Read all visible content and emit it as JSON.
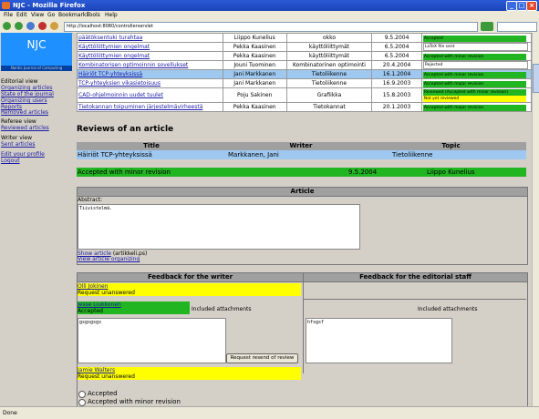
{
  "window": {
    "title": "NJC - Mozilla Firefox"
  },
  "menu": [
    "File",
    "Edit",
    "View",
    "Go",
    "Bookmarks",
    "Tools",
    "Help"
  ],
  "url": "http://localhost:8080/controllerservlet",
  "logo": {
    "title": "NJC",
    "subtitle": "Nordic Journal of Computing"
  },
  "nav": {
    "editorial_view": "Editorial view",
    "organizing_articles": "Organizing articles",
    "state_of_journal": "State of the journal",
    "organizing_users": "Organizing users",
    "reports": "Reports",
    "removed_articles": "Removed articles",
    "referee_view": "Referee view",
    "reviewed_articles": "Reviewed articles",
    "writer_view": "Writer view",
    "sent_articles": "Sent articles",
    "edit_profile": "Edit your profile",
    "logout": "Logout"
  },
  "articles": [
    {
      "title": "päätöksentuki turahtaa",
      "person": "Liippo Kunelius",
      "topic": "okko",
      "date": "9.5.2004",
      "status": "Accepted",
      "color": "#22b522"
    },
    {
      "title": "Käyttöliittymien ongelmat",
      "person": "Pekka Kaasinen",
      "topic": "käyttöliittymät",
      "date": "6.5.2004",
      "status": "LaTeX file sent",
      "color": "#ffffff"
    },
    {
      "title": "Käyttöliittymien ongelmat",
      "person": "Pekka Kaasinen",
      "topic": "käyttöliittymät",
      "date": "6.5.2004",
      "status": "Accepted with minor revision",
      "color": "#22b522"
    },
    {
      "title": "Kombinatorisen optimoinnin sovellukset",
      "person": "Jouni Tuominen",
      "topic": "Kombinatorinen optimointi",
      "date": "20.4.2004",
      "status": "Rejected",
      "color": "#ffffff"
    },
    {
      "title": "Häiriöt TCP-yhteyksissä",
      "person": "Jani Markkanen",
      "topic": "Tietoliikenne",
      "date": "16.1.2004",
      "status": "Accepted with minor revision",
      "color": "#22b522"
    },
    {
      "title": "TCP-yhteyksien vikasietoisuus",
      "person": "Jani Markkanen",
      "topic": "Tietoliikenne",
      "date": "16.9.2003",
      "status": "Accepted with major revision",
      "color": "#22b522"
    },
    {
      "title": "CAD-ohjelmoinnin uudet tuulet",
      "person": "Poju Sakinen",
      "topic": "Grafiikka",
      "date": "15.8.2003",
      "status": "Reviewed (Accepted with minor revision)",
      "status2": "Not yet reviewed",
      "color": "#22b522"
    },
    {
      "title": "Tietokannan toipuminen järjestelmävirheestä",
      "person": "Pekka Kaasinen",
      "topic": "Tietokannat",
      "date": "20.1.2003",
      "status": "Accepted with major revision",
      "color": "#22b522"
    }
  ],
  "review": {
    "heading": "Reviews of an article",
    "col_title": "Title",
    "col_writer": "Writer",
    "col_topic": "Topic",
    "title": "Häiriöt TCP-yhteyksissä",
    "writer": "Markkanen, Jani",
    "topic": "Tietoliikenne",
    "decision": "Accepted with minor revision",
    "decision_date": "9.5.2004",
    "decided_by": "Liippo Kunelius",
    "article_header": "Article",
    "abstract_label": "Abstract:",
    "abstract_text": "Tiivistelmä.",
    "show_article": "Show article",
    "show_article_file": "(artikkeli.ps)",
    "view_organizing": "View article organizing",
    "fb_writer_header": "Feedback for the writer",
    "fb_editorial_header": "Feedback for the editorial staff",
    "reviewer1_name": "Olli Jokinen",
    "reviewer1_state": "Request unanswered",
    "reviewer2_name": "Jesse Liukkonen",
    "reviewer2_state": "Accepted",
    "included_attachments": "Included attachments",
    "included_attachments2": "Included attachments",
    "writer_feedback_text": "gsgsgsgs",
    "editorial_feedback_text": "hfsgsf",
    "resend_button": "Request resend of review",
    "reviewer3_name": "Jamie Walters",
    "reviewer3_state": "Request unanswered",
    "radio_accepted": "Accepted",
    "radio_minor": "Accepted with minor revision"
  },
  "status_bar": "Done"
}
